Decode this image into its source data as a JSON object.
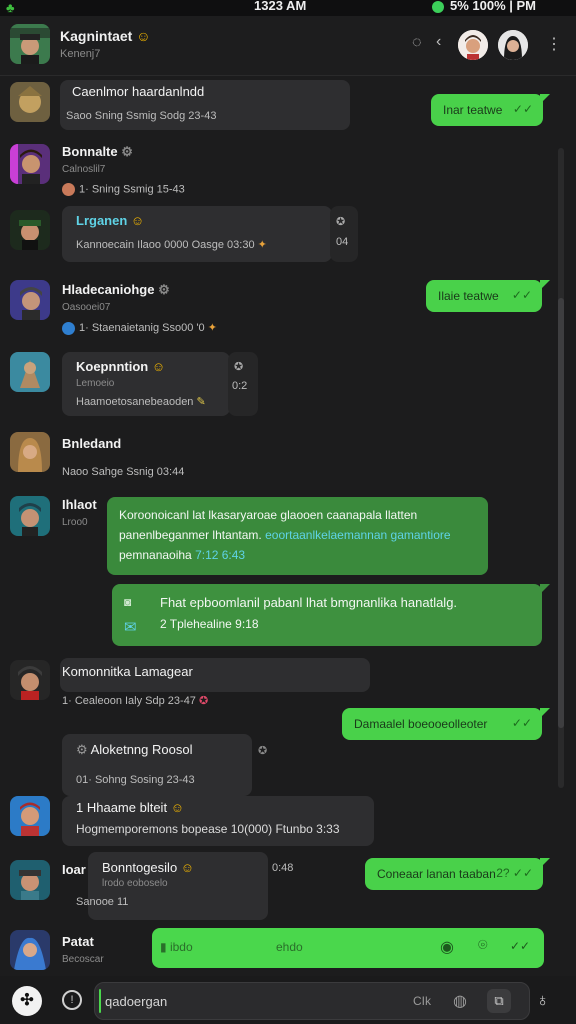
{
  "status": {
    "time": "1323 AM",
    "right": "5% 100% | PM"
  },
  "header": {
    "title": "Kagnintaet",
    "subtitle": "Kenenj7"
  },
  "messages": {
    "m1": {
      "text": "Caenlmor haardanlndd",
      "meta": "Saoo   Sning   Ssmig   Sodg   23-43"
    },
    "m1r": {
      "text": "Inar teatwe",
      "tick": "✓✓"
    },
    "m2": {
      "name": "Bonnalte",
      "sub": "Calnoslil7",
      "meta": "1·   Sning   Ssmig   15-43"
    },
    "m3": {
      "name": "Lrganen",
      "meta": "Kannoecain  Ilaoo   0000   Oasge   03:30",
      "side": "04"
    },
    "m4": {
      "name": "Hladecaniohge",
      "sub": "Oasooei07",
      "meta": "1·   Staenaietanig   Sso00   '0"
    },
    "m4r": {
      "text": "Ilaie teatwe",
      "tick": "✓✓"
    },
    "m5": {
      "name": "Koepnntion",
      "sub": "Lemoeio",
      "body": "Haamoetosanebeaoden",
      "side": "0:2"
    },
    "m6": {
      "name": "Bnledand",
      "meta": "Naoo   Sahge   Ssnig   03:44"
    },
    "m7": {
      "name": "Ihlaot",
      "sub": "Lroo0",
      "line1": "Koroonoicanl lat lkasaryaroae glaooen caanapala llatten",
      "line2a": "panenlbeganmer lhtantam. ",
      "line2b": "eoortaanlkelaemannan gamantiore",
      "line3a": "pemnanaoiha ",
      "line3b": "7:12 6:43"
    },
    "m8": {
      "line1": "Fhat epboomlanil pabanl lhat bmgnanlika hanatlalg.",
      "line2": "2 Tplehealine  9:18"
    },
    "m9": {
      "name": "Komonnitka Lamagear",
      "meta": "1·   Cealeoon   Ialy   Sdp   23-47"
    },
    "m9r": {
      "text": "Damaalel boeooeolleoter",
      "tick": "✓✓"
    },
    "m10": {
      "title": "Aloketnng Roosol",
      "meta": "01·   Sohng   Sosing   23-43"
    },
    "m11": {
      "name": "1 Hhaame blteit",
      "body": "Hogmemporemons bopease  10(000)  Ftunbo  3:33"
    },
    "m12": {
      "name": "Ioar",
      "title": "Bonntogesilo",
      "sub": "lrodo eoboselo",
      "meta": "Sanooe  11",
      "side": "0:48"
    },
    "m12r": {
      "text": "Coneaar lanan taaban",
      "tick": "2?  ✓✓"
    },
    "m13": {
      "name": "Patat",
      "sub": "Becoscar"
    },
    "composer": {
      "left": "ibdo",
      "mid": "ehdo"
    }
  },
  "input": {
    "value": "qadoergan",
    "aux": "CIk"
  },
  "colors": {
    "bg": "#1c1c1d",
    "bubble_dark": "#2e2e30",
    "bubble_green": "#49d14a",
    "bubble_mid": "#3a8a3c",
    "link": "#5fd3e6"
  },
  "icons": [
    "clover-icon",
    "dot-icon",
    "back-icon",
    "more-icon",
    "check-icon",
    "emoji-icon",
    "tool-icon",
    "camera-icon",
    "pin-icon",
    "send-icon",
    "attach-icon",
    "plus-icon",
    "mic-icon"
  ]
}
